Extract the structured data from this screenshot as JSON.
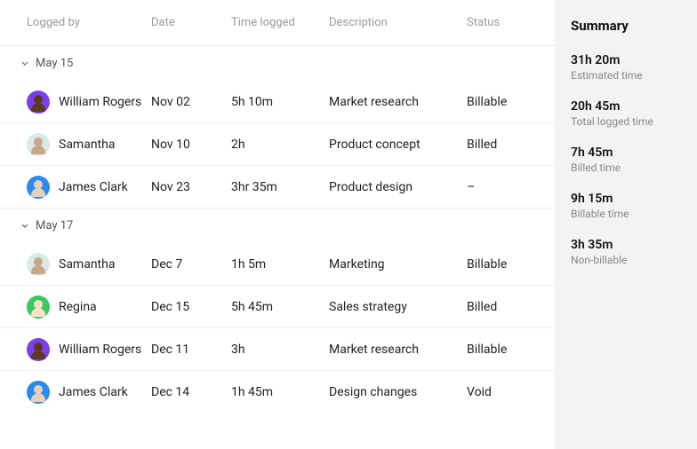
{
  "columns": {
    "logged_by": "Logged by",
    "date": "Date",
    "time_logged": "Time logged",
    "description": "Description",
    "status": "Status"
  },
  "groups": [
    {
      "label": "May 15",
      "rows": [
        {
          "name": "William Rogers",
          "avatar": "purple",
          "date": "Nov 02",
          "time": "5h 10m",
          "desc": "Market research",
          "status": "Billable"
        },
        {
          "name": "Samantha",
          "avatar": "teal",
          "date": "Nov 10",
          "time": "2h",
          "desc": "Product concept",
          "status": "Billed"
        },
        {
          "name": "James Clark",
          "avatar": "blue",
          "date": "Nov 23",
          "time": "3hr 35m",
          "desc": "Product design",
          "status": "–"
        }
      ]
    },
    {
      "label": "May 17",
      "rows": [
        {
          "name": "Samantha",
          "avatar": "teal",
          "date": "Dec 7",
          "time": "1h 5m",
          "desc": "Marketing",
          "status": "Billable"
        },
        {
          "name": "Regina",
          "avatar": "green",
          "date": "Dec 15",
          "time": "5h 45m",
          "desc": "Sales strategy",
          "status": "Billed"
        },
        {
          "name": "William Rogers",
          "avatar": "purple",
          "date": "Dec 11",
          "time": "3h",
          "desc": "Market research",
          "status": "Billable"
        },
        {
          "name": "James Clark",
          "avatar": "blue",
          "date": "Dec 14",
          "time": "1h 45m",
          "desc": "Design changes",
          "status": "Void"
        }
      ]
    }
  ],
  "summary": {
    "title": "Summary",
    "items": [
      {
        "value": "31h 20m",
        "label": "Estimated time"
      },
      {
        "value": "20h 45m",
        "label": "Total logged time"
      },
      {
        "value": "7h 45m",
        "label": "Billed time"
      },
      {
        "value": "9h 15m",
        "label": "Billable time"
      },
      {
        "value": "3h 35m",
        "label": "Non-billable"
      }
    ]
  }
}
